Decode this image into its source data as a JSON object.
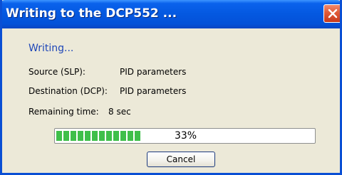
{
  "window": {
    "title": "Writing to the DCP552 ...",
    "colors": {
      "titlebar": "#0458e0",
      "close": "#e05a37",
      "body": "#ece9d8",
      "progress_fill": "#3fbf4a",
      "writing_text": "#1f47b8"
    },
    "icons": {
      "close": "close-icon"
    }
  },
  "dialog": {
    "status": "Writing...",
    "source_label": "Source (SLP):",
    "source_value": "PID parameters",
    "destination_label": "Destination (DCP):",
    "destination_value": "PID parameters",
    "remaining_label": "Remaining time:",
    "remaining_value": "8 sec",
    "progress_percent": 33,
    "progress_text": "33%",
    "cancel_label": "Cancel"
  }
}
